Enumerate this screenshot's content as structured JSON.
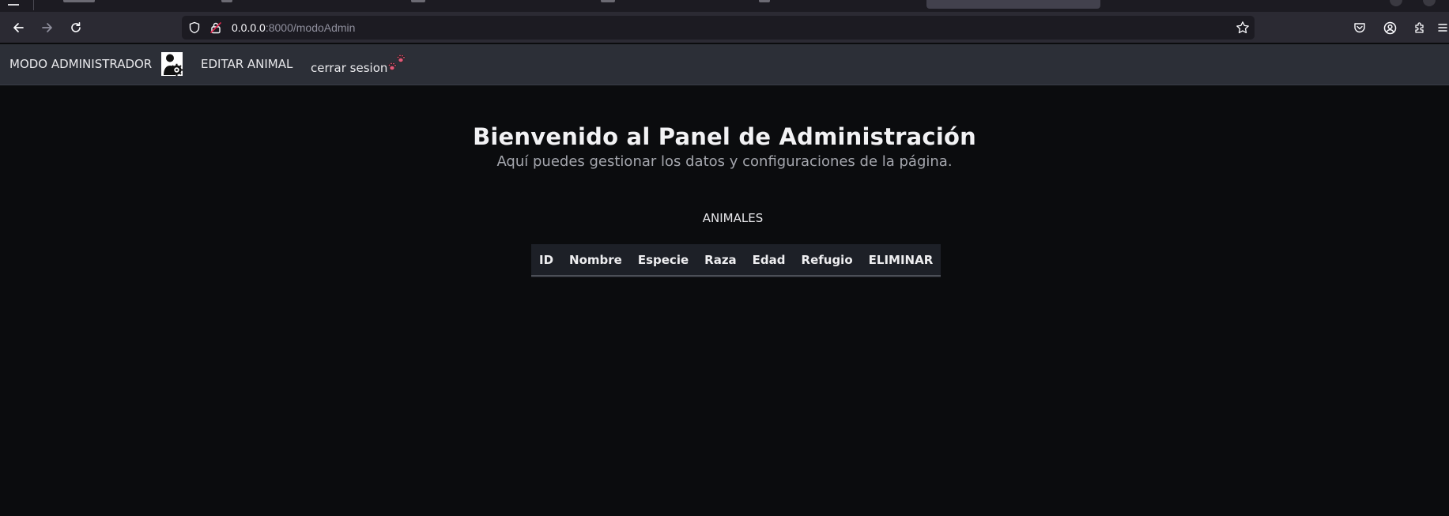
{
  "browser": {
    "url_host": "0.0.0.0",
    "url_path": ":8000/modoAdmin"
  },
  "header": {
    "admin_title": "MODO ADMINISTRADOR",
    "edit_animal": "EDITAR ANIMAL",
    "logout": "cerrar sesion"
  },
  "main": {
    "title": "Bienvenido al Panel de Administración",
    "subtitle": "Aquí puedes gestionar los datos y configuraciones de la página.",
    "section_title": "ANIMALES",
    "table": {
      "columns": [
        "ID",
        "Nombre",
        "Especie",
        "Raza",
        "Edad",
        "Refugio",
        "ELIMINAR"
      ],
      "rows": []
    }
  },
  "colors": {
    "page_bg": "#0b0c0e",
    "header_bg": "#2c2f37",
    "browser_toolbar": "#2b2a33",
    "paw_accent": "#e05a78"
  }
}
